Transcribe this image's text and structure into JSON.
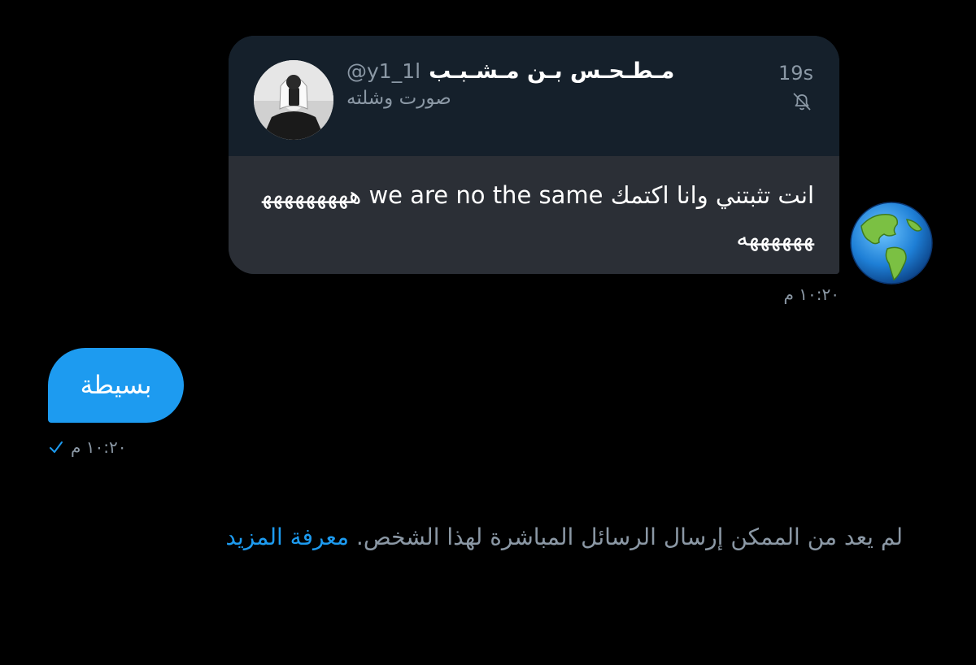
{
  "conversation": {
    "incoming": {
      "avatar_icon": "earth-globe-icon",
      "shared_tweet": {
        "author_display_name": "مـطـحـس بـن مـشـبـب",
        "author_handle": "@y1_1l",
        "author_subtext": "صورت وشلته",
        "time_ago": "19s",
        "status_icon": "muted-notification-icon",
        "avatar_icon": "profile-photo-icon"
      },
      "message_text": "انت تثبتني وانا اكتمك we are no the same هههههههههههههههه",
      "timestamp": "١٠:٢٠ م"
    },
    "outgoing": {
      "message_text": "بسيطة",
      "timestamp": "١٠:٢٠ م",
      "status_icon": "sent-checkmark-icon"
    }
  },
  "footer": {
    "notice_text": "لم يعد من الممكن إرسال الرسائل المباشرة لهذا الشخص.",
    "learn_more_label": "معرفة المزيد"
  },
  "colors": {
    "background": "#000000",
    "accent": "#1d9bf0",
    "secondary_text": "#8b98a5",
    "card_header": "#15202b",
    "card_body": "#2b2f36"
  }
}
